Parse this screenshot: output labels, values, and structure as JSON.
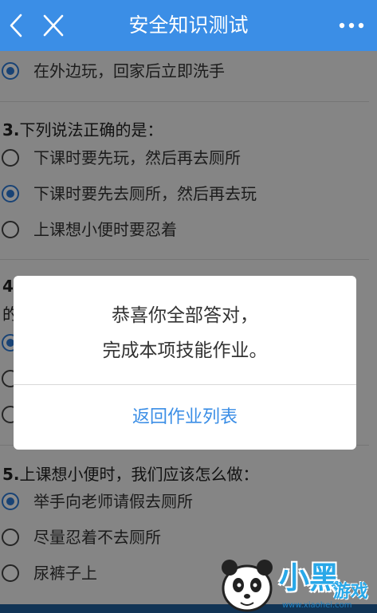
{
  "header": {
    "title": "安全知识测试",
    "back_icon": "chevron-left-icon",
    "close_icon": "close-icon",
    "more_icon": "more-dots-icon",
    "bg_color": "#3b8ee6"
  },
  "questions": [
    {
      "title": "",
      "options": [
        {
          "label": "在外边玩，回家后立即洗手",
          "checked": true
        }
      ]
    },
    {
      "number": "3.",
      "text": "下列说法正确的是：",
      "options": [
        {
          "label": "下课时要先玩，然后再去厕所",
          "checked": false
        },
        {
          "label": "下课时要先去厕所，然后再去玩",
          "checked": true
        },
        {
          "label": "上课想小便时要忍着",
          "checked": false
        }
      ]
    },
    {
      "number": "4.",
      "text": "",
      "partial_second_line": "的"
    },
    {
      "number": "5.",
      "text": "上课想小便时，我们应该怎么做：",
      "options": [
        {
          "label": "举手向老师请假去厕所",
          "checked": true
        },
        {
          "label": "尽量忍着不去厕所",
          "checked": false
        },
        {
          "label": "尿裤子上",
          "checked": false
        }
      ]
    }
  ],
  "dialog": {
    "line1": "恭喜你全部答对，",
    "line2": "完成本项技能作业。",
    "button": "返回作业列表"
  },
  "watermark": {
    "brand": "小黑",
    "brand2": "游戏",
    "url": "www.xiaohei.com",
    "icon": "panda-logo-icon"
  }
}
